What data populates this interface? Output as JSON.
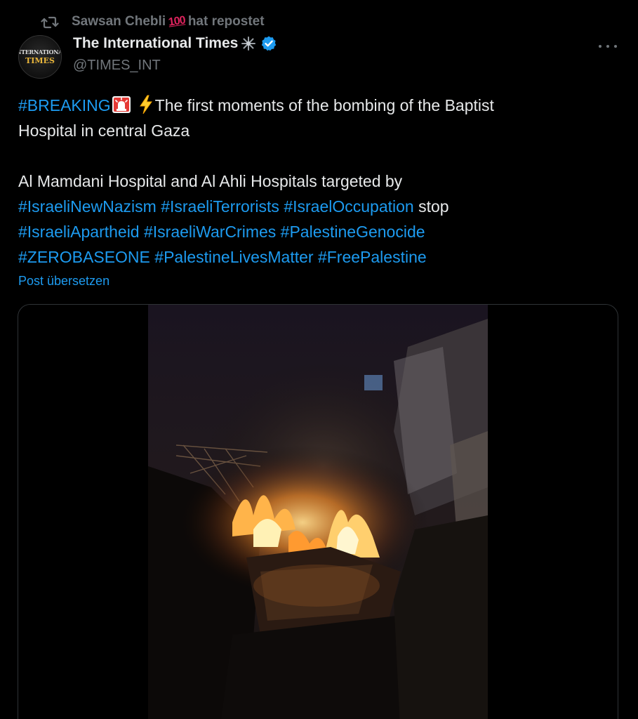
{
  "repost": {
    "user": "Sawsan Chebli",
    "emoji": "100",
    "suffix": "hat repostet"
  },
  "author": {
    "name": "The International Times",
    "handle": "@TIMES_INT",
    "avatar_line1": "INTERNATIONAL",
    "avatar_line2": "TIMES",
    "verified_color": "#1d9bf0"
  },
  "tweet": {
    "line1_hashtag": "#BREAKING",
    "line1_text": "The first moments of the bombing of the Baptist",
    "line2_text": "Hospital in central Gaza",
    "line3_text": "Al Mamdani Hospital and Al Ahli Hospitals targeted by",
    "line4_tag1": "#IsraeliNewNazism",
    "line4_tag2": "#IsraeliTerrorists",
    "line4_tag3": "#IsraelOccupation",
    "line4_text": "stop",
    "line5_tag1": "#IsraeliApartheid",
    "line5_tag2": "#IsraeliWarCrimes",
    "line5_tag3": "#PalestineGenocide",
    "line6_tag1": "#ZEROBASEONE",
    "line6_tag2": "#PalestineLivesMatter",
    "line6_tag3": "#FreePalestine"
  },
  "translate_label": "Post übersetzen",
  "colors": {
    "background": "#000000",
    "text": "#e7e9ea",
    "muted": "#71767b",
    "link": "#1d9bf0"
  },
  "icons": [
    "repost-icon",
    "star-icon",
    "verified-badge-icon",
    "more-icon",
    "siren-emoji",
    "lightning-emoji"
  ]
}
